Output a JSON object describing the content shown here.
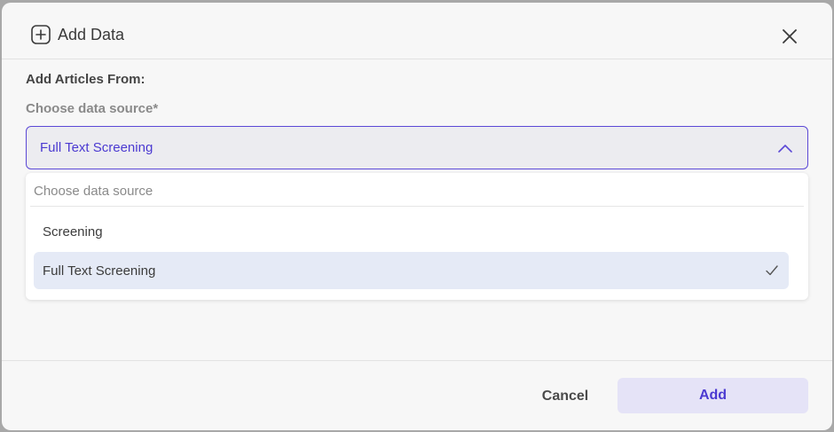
{
  "dialog": {
    "title": "Add Data",
    "icon": "plus-square-icon",
    "close_icon": "close-icon"
  },
  "form": {
    "section_label": "Add Articles From:",
    "field_label": "Choose data source*",
    "selected_value": "Full Text Screening",
    "chevron_icon": "chevron-up-icon"
  },
  "dropdown": {
    "search_placeholder": "Choose data source",
    "options": [
      {
        "label": "Screening",
        "selected": false
      },
      {
        "label": "Full Text Screening",
        "selected": true
      }
    ],
    "check_icon": "check-icon"
  },
  "footer": {
    "cancel_label": "Cancel",
    "add_label": "Add"
  },
  "colors": {
    "accent": "#5b48d6",
    "accent_text": "#4b3ad1",
    "selected_option_bg": "#e5eaf6",
    "add_button_bg": "#e5e3f7"
  }
}
